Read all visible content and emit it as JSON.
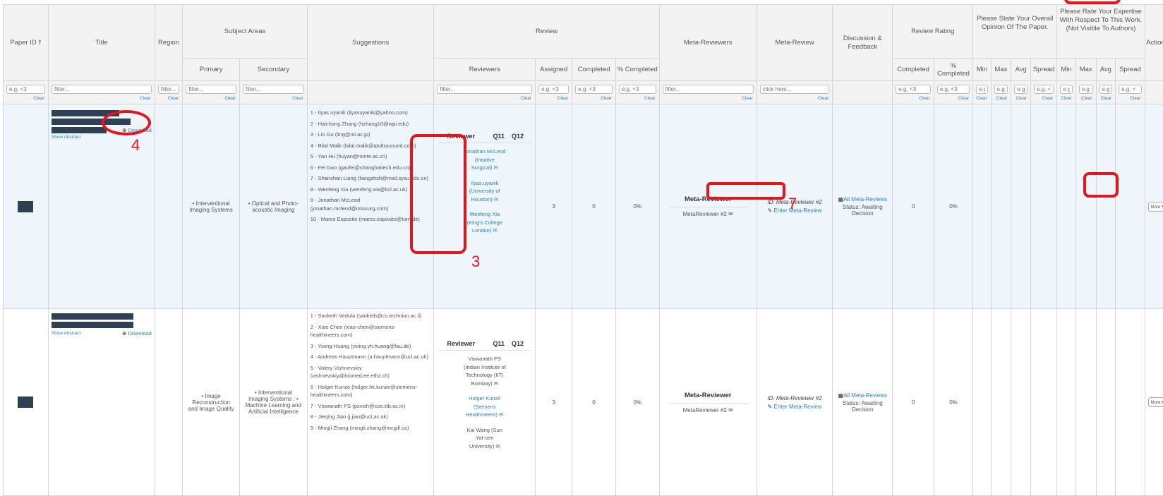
{
  "headers": {
    "paper_id": "Paper ID",
    "title": "Title",
    "region": "Region",
    "subject_areas": "Subject Areas",
    "primary": "Primary",
    "secondary": "Secondary",
    "suggestions": "Suggestions",
    "review": "Review",
    "reviewers": "Reviewers",
    "assigned": "Assigned",
    "completed": "Completed",
    "pct_completed": "% Completed",
    "meta_reviewers": "Meta-Reviewers",
    "meta_review": "Meta-Review",
    "discussion": "Discussion & Feedback",
    "review_rating": "Review Rating",
    "rr_completed": "Completed",
    "rr_pct_completed": "% Completed",
    "opinion": "Please State Your Overall Opinion Of The Paper.",
    "expertise": "Please Rate Your Expertise With Respect To This Work. (Not Visible To Authors)",
    "min": "Min",
    "max": "Max",
    "avg": "Avg",
    "spread": "Spread",
    "actions": "Actions"
  },
  "filters": {
    "eg": "e.g. <3",
    "filter": "filter...",
    "filter_short": "filter...",
    "click_here": "click here...",
    "clear": "Clear",
    "tiny": "e.g",
    "tiny2": "e.g. <"
  },
  "row1": {
    "download": "Download",
    "show_abstract": "Show Abstract",
    "primary": "• Interventional Imaging Systems",
    "secondary": "• Optical and Photo-acoustic Imaging",
    "suggestions": [
      "1 - Ilyas uyanik (ilyasuyanik@yahoo.com)",
      "2 - Haichong Zhang (hzhang10@wpi.edu)",
      "3 - Lin Gu (ling@nii.ac.jp)",
      "4 - Bilal Malik (bilal.malik@qtultrasound.com)",
      "5 - Yan Hu (huyan@nimte.ac.cn)",
      "6 - Fei Gao (gaofei@shanghaitech.edu.cn)",
      "7 - Shanshan Liang (liangshsh@mail.sysu.edu.cn)",
      "8 - Wenfeng Xia (wenfeng.xia@kcl.ac.uk)",
      "9 - Jonathan McLeod (jonathan.mcleod@intusurg.com)",
      "10 - Marco Esposito (marco.esposito@tum.de)"
    ],
    "reviewer_head": "Reviewer",
    "q11": "Q11",
    "q12": "Q12",
    "reviewers": [
      "Jonathan McLeod (Intuitive Surgical) ✉",
      "Ilyas uyanik (University of Houston) ✉",
      "Wenfeng Xia (King's College London) ✉"
    ],
    "assigned": "3",
    "completed": "0",
    "pct": "0%",
    "meta_reviewer_title": "Meta-Reviewer",
    "meta_reviewer_name": "MetaReviewer #2 ✉",
    "meta_review_id": "ID: Meta-Reviewer #2",
    "enter_meta_review": "Enter Meta-Review",
    "all_meta_reviews": "All Meta-Reviews",
    "status": "Status: Awaiting Decision",
    "rr_completed": "0",
    "rr_pct": "0%",
    "action": "More"
  },
  "row2": {
    "download": "Download",
    "show_abstract": "Show Abstract",
    "primary": "• Image Reconstruction and Image Quality",
    "secondary": "• Interventional Imaging Systems ; • Machine Learning and Artificial Intelligence",
    "suggestions": [
      "1 - Sanketh Vedula (sanketh@cs.technion.ac.il)",
      "2 - Xiao Chen (xiao-chen@siemens-healthineers.com)",
      "3 - Yixing Huang (yixing.yh.huang@fau.de)",
      "4 - Andreas Hauptmann (a.hauptmann@ucl.ac.uk)",
      "5 - Valery Vishnevskiy (vishnevskiy@biomed.ee.ethz.ch)",
      "6 - Holger Kunze (holger.hk.kunze@siemens-healthineers.com)",
      "7 - Viswanath PS (psvish@cse.iitb.ac.in)",
      "8 - Jieqing Jiao (j.jiao@ucl.ac.uk)",
      "9 - Mingli Zhang (mingli.zhang@mcgill.ca)"
    ],
    "reviewer_head": "Reviewer",
    "q11": "Q11",
    "q12": "Q12",
    "reviewers": [
      "Viswanath PS (Indian Institute of Technology (IIT) Bombay) ✉",
      "Holger Kunze (Siemens Healthineers) ✉",
      "Kai Wang (Sun Yat-sen University) ✉"
    ],
    "assigned": "3",
    "completed": "0",
    "pct": "0%",
    "meta_reviewer_title": "Meta-Reviewer",
    "meta_reviewer_name": "MetaReviewer #2 ✉",
    "meta_review_id": "ID: Meta-Reviewer #2",
    "enter_meta_review": "Enter Meta-Review",
    "all_meta_reviews": "All Meta-Reviews",
    "status": "Status: Awaiting Decision",
    "rr_completed": "0",
    "rr_pct": "0%",
    "action": "More"
  },
  "annotations": {
    "a3": "3",
    "a4": "4",
    "a7": "7"
  }
}
